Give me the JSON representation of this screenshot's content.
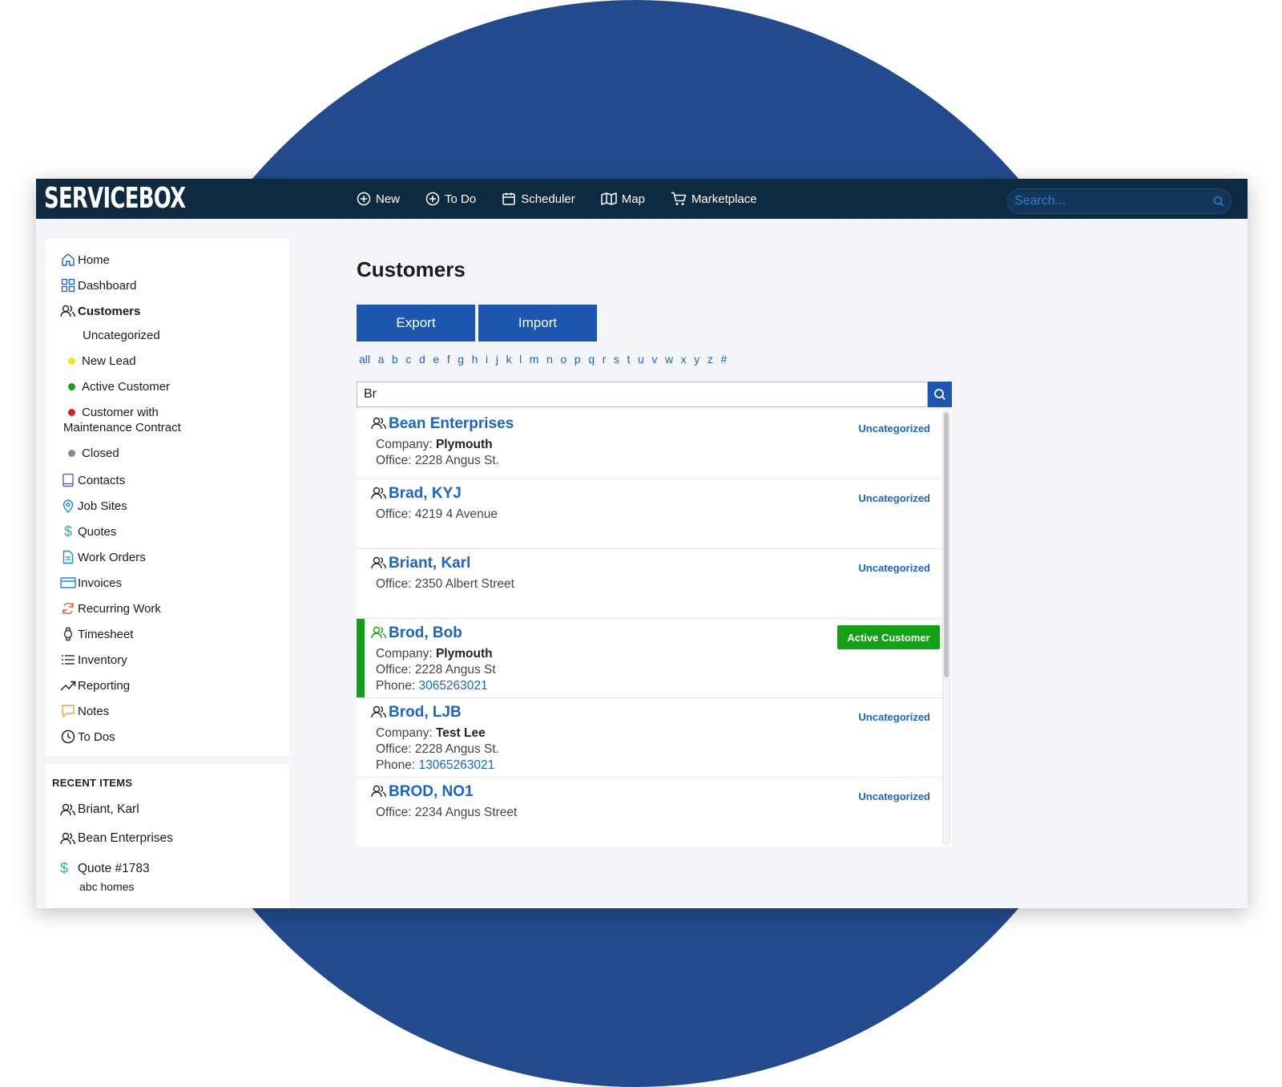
{
  "app": {
    "logo": "SERVICEBOX",
    "nav": [
      {
        "label": "New",
        "icon": "plus-circle-icon"
      },
      {
        "label": "To Do",
        "icon": "plus-circle-icon"
      },
      {
        "label": "Scheduler",
        "icon": "calendar-icon"
      },
      {
        "label": "Map",
        "icon": "map-icon"
      },
      {
        "label": "Marketplace",
        "icon": "cart-icon"
      }
    ],
    "search_placeholder": "Search..."
  },
  "sidebar": {
    "items": [
      {
        "label": "Home",
        "icon": "home-icon"
      },
      {
        "label": "Dashboard",
        "icon": "dashboard-icon"
      },
      {
        "label": "Customers",
        "icon": "users-icon"
      },
      {
        "label": "Contacts",
        "icon": "book-icon"
      },
      {
        "label": "Job Sites",
        "icon": "location-pin-icon"
      },
      {
        "label": "Quotes",
        "icon": "dollar-icon"
      },
      {
        "label": "Work Orders",
        "icon": "document-icon"
      },
      {
        "label": "Invoices",
        "icon": "card-icon"
      },
      {
        "label": "Recurring Work",
        "icon": "refresh-icon"
      },
      {
        "label": "Timesheet",
        "icon": "watch-icon"
      },
      {
        "label": "Inventory",
        "icon": "list-icon"
      },
      {
        "label": "Reporting",
        "icon": "trend-icon"
      },
      {
        "label": "Notes",
        "icon": "note-icon"
      },
      {
        "label": "To Dos",
        "icon": "clock-icon"
      }
    ],
    "customer_categories": [
      {
        "label": "Uncategorized",
        "color": ""
      },
      {
        "label": "New Lead",
        "color": "#f2e51c"
      },
      {
        "label": "Active Customer",
        "color": "#14a016"
      },
      {
        "label": "Customer with",
        "label2": "Maintenance Contract",
        "color": "#e01b1b"
      },
      {
        "label": "Closed",
        "color": "#8a8a8a"
      }
    ]
  },
  "recent": {
    "title": "RECENT ITEMS",
    "items": [
      {
        "label": "Briant, Karl",
        "icon": "users-icon"
      },
      {
        "label": "Bean Enterprises",
        "icon": "users-icon"
      },
      {
        "label": "Quote #1783",
        "icon": "dollar-icon",
        "sub": "abc homes"
      }
    ]
  },
  "main": {
    "title": "Customers",
    "export_label": "Export",
    "import_label": "Import",
    "alphabet": [
      "all",
      "a",
      "b",
      "c",
      "d",
      "e",
      "f",
      "g",
      "h",
      "i",
      "j",
      "k",
      "l",
      "m",
      "n",
      "o",
      "p",
      "q",
      "r",
      "s",
      "t",
      "u",
      "v",
      "w",
      "x",
      "y",
      "z",
      "#"
    ],
    "search_value": "Br",
    "customers": [
      {
        "name": "Bean Enterprises",
        "tag": "Uncategorized",
        "company_label": "Company:",
        "company": "Plymouth",
        "office": "Office: 2228 Angus St."
      },
      {
        "name": "Brad, KYJ",
        "tag": "Uncategorized",
        "office": "Office: 4219 4 Avenue"
      },
      {
        "name": "Briant, Karl",
        "tag": "Uncategorized",
        "office": "Office: 2350 Albert Street"
      },
      {
        "name": "Brod, Bob",
        "tag": "Active Customer",
        "company_label": "Company:",
        "company": "Plymouth",
        "office": "Office: 2228 Angus St",
        "phone_label": "Phone:",
        "phone": "3065263021"
      },
      {
        "name": "Brod, LJB",
        "tag": "Uncategorized",
        "company_label": "Company:",
        "company": "Test Lee",
        "office": "Office: 2228 Angus St.",
        "phone_label": "Phone:",
        "phone": "13065263021"
      },
      {
        "name": "BROD, NO1",
        "tag": "Uncategorized",
        "office": "Office: 2234 Angus Street"
      }
    ]
  },
  "colors": {
    "brand_navy": "#0e2a40",
    "accent_blue": "#1c56b0",
    "link_blue": "#1c64c8",
    "active_green": "#14a016",
    "background_circle": "#224a8c"
  }
}
